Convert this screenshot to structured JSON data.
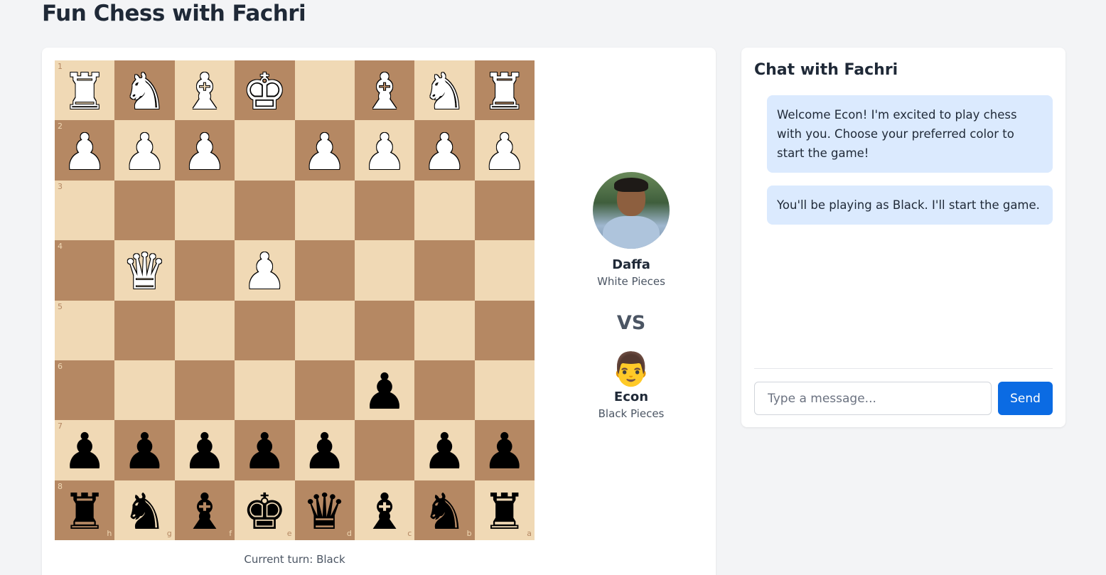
{
  "page": {
    "title": "Fun Chess with Fachri"
  },
  "board": {
    "ranks": [
      "1",
      "2",
      "3",
      "4",
      "5",
      "6",
      "7",
      "8"
    ],
    "files": [
      "h",
      "g",
      "f",
      "e",
      "d",
      "c",
      "b",
      "a"
    ],
    "squares": [
      [
        "wR",
        "wN",
        "wB",
        "wK",
        "",
        "wB",
        "wN",
        "wR"
      ],
      [
        "wP",
        "wP",
        "wP",
        "",
        "wP",
        "wP",
        "wP",
        "wP"
      ],
      [
        "",
        "",
        "",
        "",
        "",
        "",
        "",
        ""
      ],
      [
        "",
        "wQ",
        "",
        "wP",
        "",
        "",
        "",
        ""
      ],
      [
        "",
        "",
        "",
        "",
        "",
        "",
        "",
        ""
      ],
      [
        "",
        "",
        "",
        "",
        "",
        "bP",
        "",
        ""
      ],
      [
        "bP",
        "bP",
        "bP",
        "bP",
        "bP",
        "",
        "bP",
        "bP"
      ],
      [
        "bR",
        "bN",
        "bB",
        "bK",
        "bQ",
        "bB",
        "bN",
        "bR"
      ]
    ],
    "colors": {
      "light": "#f0d9b5",
      "dark": "#b58863"
    }
  },
  "turn": {
    "text": "Current turn: Black"
  },
  "players": {
    "white": {
      "name": "Daffa",
      "role": "White Pieces",
      "avatar": "photo-avatar"
    },
    "vs": "VS",
    "black": {
      "name": "Econ",
      "role": "Black Pieces",
      "avatar": "👨"
    }
  },
  "chat": {
    "title": "Chat with Fachri",
    "messages": [
      "Welcome Econ! I'm excited to play chess with you. Choose your preferred color to start the game!",
      "You'll be playing as Black. I'll start the game."
    ],
    "input_placeholder": "Type a message...",
    "send_label": "Send",
    "accent_color": "#0b6be3"
  }
}
